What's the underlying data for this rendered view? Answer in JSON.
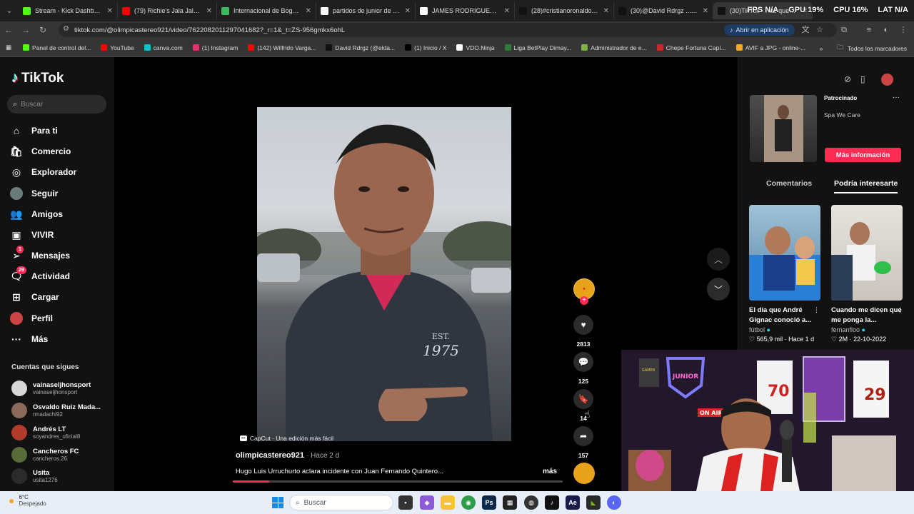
{
  "browser": {
    "tabs": [
      {
        "title": "Stream - Kick Dashboard",
        "color": "#53fc18"
      },
      {
        "title": "(79) Richie's Jala Jala - Yo",
        "color": "#ff0000"
      },
      {
        "title": "Internacional de Bogotá \\",
        "color": "#3dbb5f"
      },
      {
        "title": "partidos de junior de barr",
        "color": "#ffffff"
      },
      {
        "title": "JAMES RODRIGUEZ - Busc",
        "color": "#ffffff"
      },
      {
        "title": "(28)#cristianoronaldo #gc",
        "color": "#111111"
      },
      {
        "title": "(30)@David Rdrgz ... | Tik",
        "color": "#111111"
      },
      {
        "title": "(30)TikTok - Haz que tu d",
        "color": "#111111"
      }
    ],
    "overlay": {
      "fps": "FPS N/A",
      "gpu": "GPU 19%",
      "cpu": "CPU 16%",
      "lat": "LAT N/A"
    },
    "url": "tiktok.com/@olimpicastereo921/video/7622082011297041682?_r=1&_t=ZS-956gmkx6ohL",
    "open_app": "Abrir en aplicación",
    "bookmarks": [
      {
        "label": "Panel de control del...",
        "color": "#53fc18"
      },
      {
        "label": "YouTube",
        "color": "#ff0000"
      },
      {
        "label": "canva.com",
        "color": "#00c4cc"
      },
      {
        "label": "(1) Instagram",
        "color": "#e1306c"
      },
      {
        "label": "(142) Wilfrido Varga...",
        "color": "#ff0000"
      },
      {
        "label": "David Rdrgz (@elda...",
        "color": "#111111"
      },
      {
        "label": "(1) Inicio / X",
        "color": "#000000"
      },
      {
        "label": "VDO.Ninja",
        "color": "#ffffff"
      },
      {
        "label": "Liga BetPlay Dimay...",
        "color": "#2e7d32"
      },
      {
        "label": "Administrador de e...",
        "color": "#7cb342"
      },
      {
        "label": "Chepe Fortuna Capí...",
        "color": "#c62828"
      },
      {
        "label": "AVIF a JPG - online-...",
        "color": "#f9a825"
      }
    ],
    "bookmarks_more": "»",
    "all_bookmarks": "Todos los marcadores"
  },
  "tiktok": {
    "logo": "TikTok",
    "search_placeholder": "Buscar",
    "nav": [
      {
        "label": "Para ti",
        "icon": "home-icon",
        "glyph": "⌂"
      },
      {
        "label": "Comercio",
        "icon": "shop-icon",
        "glyph": "🛍"
      },
      {
        "label": "Explorador",
        "icon": "compass-icon",
        "glyph": "◎"
      },
      {
        "label": "Seguir",
        "icon": "following-avatar-icon",
        "glyph": ""
      },
      {
        "label": "Amigos",
        "icon": "friends-icon",
        "glyph": "👥"
      },
      {
        "label": "VIVIR",
        "icon": "live-icon",
        "glyph": "▣"
      },
      {
        "label": "Mensajes",
        "icon": "messages-icon",
        "glyph": "➢",
        "badge": "1"
      },
      {
        "label": "Actividad",
        "icon": "activity-icon",
        "glyph": "🗨",
        "badge": "29"
      },
      {
        "label": "Cargar",
        "icon": "upload-icon",
        "glyph": "⊞"
      },
      {
        "label": "Perfil",
        "icon": "profile-icon",
        "glyph": ""
      },
      {
        "label": "Más",
        "icon": "more-icon",
        "glyph": "···"
      }
    ],
    "following_title": "Cuentas que sigues",
    "following": [
      {
        "name": "vainaseljhonsport",
        "handle": "vainaseljhonsport",
        "color": "#d8d8d8"
      },
      {
        "name": "Osvaldo Ruiz Mada...",
        "handle": "rmadachi92",
        "color": "#8a6b5a"
      },
      {
        "name": "Andrés LT",
        "handle": "soyandres_oficial8",
        "color": "#b23b2b"
      },
      {
        "name": "Cancheros FC",
        "handle": "cancheros.26",
        "color": "#5a6b3a"
      },
      {
        "name": "Usita",
        "handle": "usita1276",
        "color": "#2b2b2b"
      }
    ],
    "video": {
      "capcut": "CapCut · Una edición más fácil",
      "author": "olimpicastereo921",
      "ago": "· Hace 2 d",
      "description": "Hugo Luis Urruchurto aclara incidente con Juan Fernando Quintero...",
      "more": "más",
      "progress": 0.11,
      "likes": "2813",
      "comments": "125",
      "saves": "14",
      "shares": "157"
    },
    "right": {
      "sponsored": "Patrocinado",
      "sponsor_name": "Spa We Care",
      "more_info": "Más información",
      "tab_comments": "Comentarios",
      "tab_interest": "Podría interesarte",
      "cards": [
        {
          "title": "El día que André Gignac conoció a...",
          "author": "fútbol",
          "stats": "♡ 565,9 mil · Hace 1 d"
        },
        {
          "title": "Cuando me dicen que me ponga la...",
          "author": "fernanfloo",
          "stats": "♡ 2M · 22-10-2022"
        }
      ]
    }
  },
  "webcam": {
    "sign_junior": "JUNIOR",
    "sign_onair": "ON AIR",
    "jersey_1": "70",
    "jersey_2": "29"
  },
  "taskbar": {
    "temp": "6°C",
    "weather": "Despejado",
    "search": "Buscar"
  }
}
